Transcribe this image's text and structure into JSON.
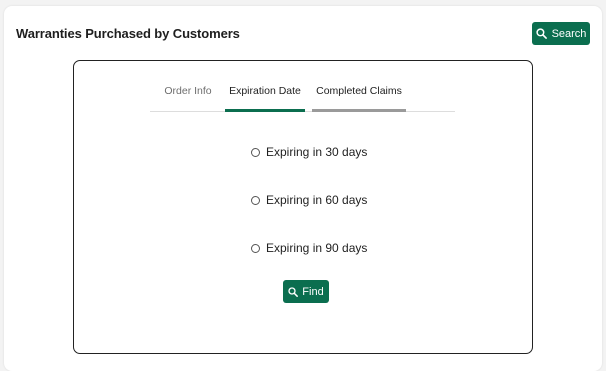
{
  "header": {
    "title": "Warranties Purchased by Customers",
    "search_label": "Search"
  },
  "tabs": [
    {
      "label": "Order Info",
      "state": "inactive"
    },
    {
      "label": "Expiration Date",
      "state": "active"
    },
    {
      "label": "Completed Claims",
      "state": "hover"
    }
  ],
  "options": [
    {
      "label": "Expiring in 30 days",
      "checked": false
    },
    {
      "label": "Expiring in 60 days",
      "checked": false
    },
    {
      "label": "Expiring in 90 days",
      "checked": false
    }
  ],
  "find_label": "Find",
  "colors": {
    "accent": "#0b6e4f",
    "border": "#222222",
    "tab_inactive_text": "#6e6e6e",
    "tab_hover_underline": "#9a9a9a"
  },
  "icons": {
    "search_button": "search-icon",
    "find_button": "search-icon"
  }
}
